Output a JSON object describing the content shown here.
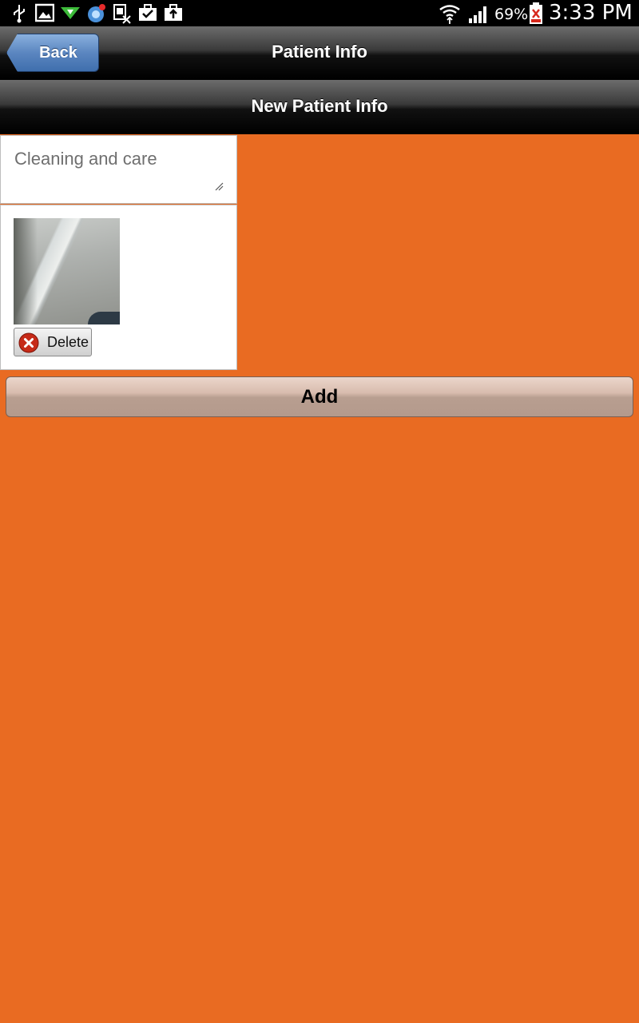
{
  "status_bar": {
    "battery_percent": "69%",
    "time": "3:33 PM",
    "left_icons": [
      "usb-icon",
      "gallery-icon",
      "download-icon",
      "browser-icon",
      "sim-icon",
      "briefcase-check-icon",
      "briefcase-upload-icon"
    ],
    "right_icons": [
      "wifi-icon",
      "signal-icon",
      "battery-icon"
    ]
  },
  "header": {
    "back_label": "Back",
    "title": "Patient Info"
  },
  "subheader": {
    "title": "New Patient Info"
  },
  "form": {
    "notes_value": "Cleaning and care",
    "delete_label": "Delete",
    "add_label": "Add"
  },
  "colors": {
    "background": "#e96b22",
    "back_button": "#5b86c0",
    "add_button": "#d8bcae",
    "delete_icon": "#c62a18"
  }
}
